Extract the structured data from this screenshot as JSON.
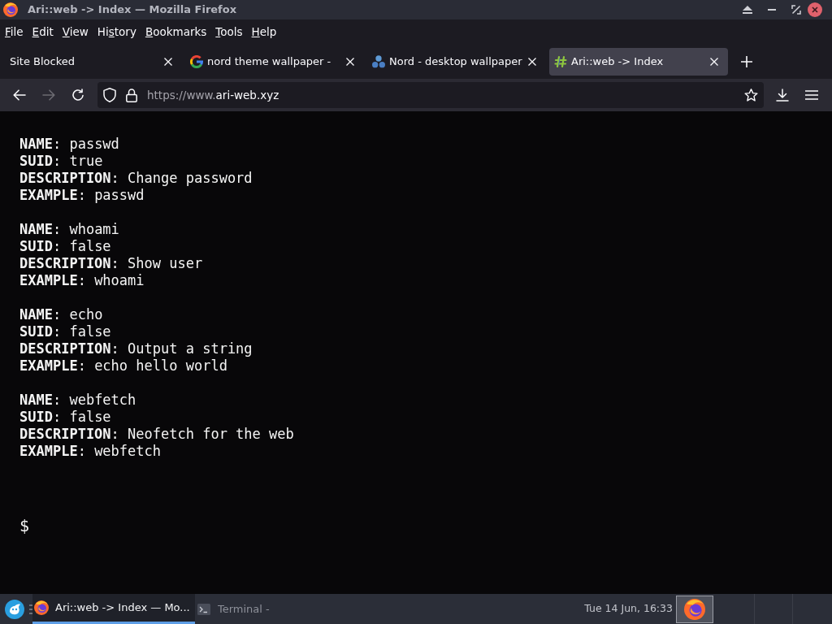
{
  "window": {
    "title": "Ari::web -> Index — Mozilla Firefox"
  },
  "menu": [
    {
      "key": "F",
      "post": "ile"
    },
    {
      "key": "E",
      "post": "dit"
    },
    {
      "key": "V",
      "post": "iew"
    },
    {
      "pre": "Hi",
      "key": "s",
      "post": "tory"
    },
    {
      "key": "B",
      "post": "ookmarks"
    },
    {
      "key": "T",
      "post": "ools"
    },
    {
      "key": "H",
      "post": "elp"
    }
  ],
  "tabs": [
    {
      "title": "Site Blocked",
      "kind": "plain",
      "selected": false
    },
    {
      "title": "nord theme wallpaper -",
      "kind": "search",
      "selected": false
    },
    {
      "title": "Nord - desktop wallpaper",
      "kind": "dots",
      "selected": false
    },
    {
      "title": "Ari::web -> Index",
      "kind": "hash",
      "selected": true
    }
  ],
  "nav_buttons": [
    {
      "kind": "back",
      "disabled": false
    },
    {
      "kind": "forward",
      "disabled": true
    },
    {
      "kind": "reload",
      "disabled": false
    }
  ],
  "address_bar": {
    "url_prefix": "https://www.",
    "url_domain": "ari-web.xyz"
  },
  "terminal": {
    "entries": [
      {
        "lines": [
          "**NAME**: passwd",
          "**SUID**: true",
          "**DESCRIPTION**: Change password",
          "**EXAMPLE**: passwd"
        ]
      },
      {
        "lines": [
          "**NAME**: whoami",
          "**SUID**: false",
          "**DESCRIPTION**: Show user",
          "**EXAMPLE**: whoami"
        ]
      },
      {
        "lines": [
          "**NAME**: echo",
          "**SUID**: false",
          "**DESCRIPTION**: Output a string",
          "**EXAMPLE**: echo hello world"
        ]
      },
      {
        "lines": [
          "**NAME**: webfetch",
          "**SUID**: false",
          "**DESCRIPTION**: Neofetch for the web",
          "**EXAMPLE**: webfetch"
        ]
      }
    ],
    "prompt": "$"
  },
  "taskbar": {
    "tasks": [
      {
        "title": "Ari::web -> Index — Mo...",
        "kind": "browser",
        "selected": true
      },
      {
        "title": "Terminal -",
        "kind": "terminal",
        "selected": false
      }
    ],
    "clock": "Tue 14 Jun, 16:33"
  }
}
